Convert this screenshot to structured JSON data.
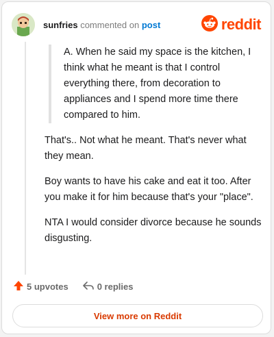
{
  "header": {
    "username": "sunfries",
    "action_text": "commented on",
    "target": "post",
    "brand": "reddit"
  },
  "comment": {
    "quote": "A. When he said my space is the kitchen, I think what he meant is that I control everything there, from decoration to appliances and I spend more time there compared to him.",
    "paragraphs": [
      "That's.. Not what he meant. That's never what they mean.",
      "Boy wants to have his cake and eat it too. After you make it for him because that's your \"place\".",
      "NTA I would consider divorce because he sounds disgusting."
    ]
  },
  "actions": {
    "upvotes": "5 upvotes",
    "replies": "0 replies"
  },
  "footer": {
    "view_more": "View more on Reddit"
  },
  "colors": {
    "brand": "#ff4500",
    "link": "#0079d3",
    "cta": "#d93a00"
  },
  "icons": {
    "upvote": "upvote-arrow-icon",
    "reply": "reply-arrow-icon",
    "brand": "reddit-snoo-icon"
  }
}
